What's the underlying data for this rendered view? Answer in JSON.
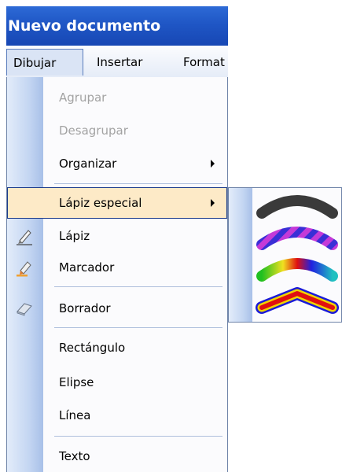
{
  "window": {
    "title": "Nuevo documento"
  },
  "menubar": {
    "items": [
      {
        "label": "Dibujar"
      },
      {
        "label": "Insertar"
      },
      {
        "label": "Format"
      }
    ]
  },
  "menu": {
    "items": [
      {
        "label": "Agrupar"
      },
      {
        "label": "Desagrupar"
      },
      {
        "label": "Organizar"
      },
      {
        "label": "Lápiz especial"
      },
      {
        "label": "Lápiz"
      },
      {
        "label": "Marcador"
      },
      {
        "label": "Borrador"
      },
      {
        "label": "Rectángulo"
      },
      {
        "label": "Elipse"
      },
      {
        "label": "Línea"
      },
      {
        "label": "Texto"
      }
    ]
  },
  "submenu": {
    "swatches": [
      {
        "name": "dark-gray-stroke",
        "colors": [
          "#3a3a3a"
        ]
      },
      {
        "name": "blue-magenta-stroke",
        "colors": [
          "#3a2fd6",
          "#c43ad8"
        ]
      },
      {
        "name": "rainbow-stroke",
        "colors": [
          "#e01010",
          "#f0e020",
          "#20c020",
          "#2020e0"
        ]
      },
      {
        "name": "red-yellow-blue-stroke",
        "colors": [
          "#1a1ad8",
          "#f0d400",
          "#e01010"
        ]
      }
    ]
  },
  "colors": {
    "titlebar": "#1f56c5",
    "highlight": "#fdeac7",
    "highlight_border": "#1b3a8a",
    "disabled_text": "#a3a3a3"
  }
}
